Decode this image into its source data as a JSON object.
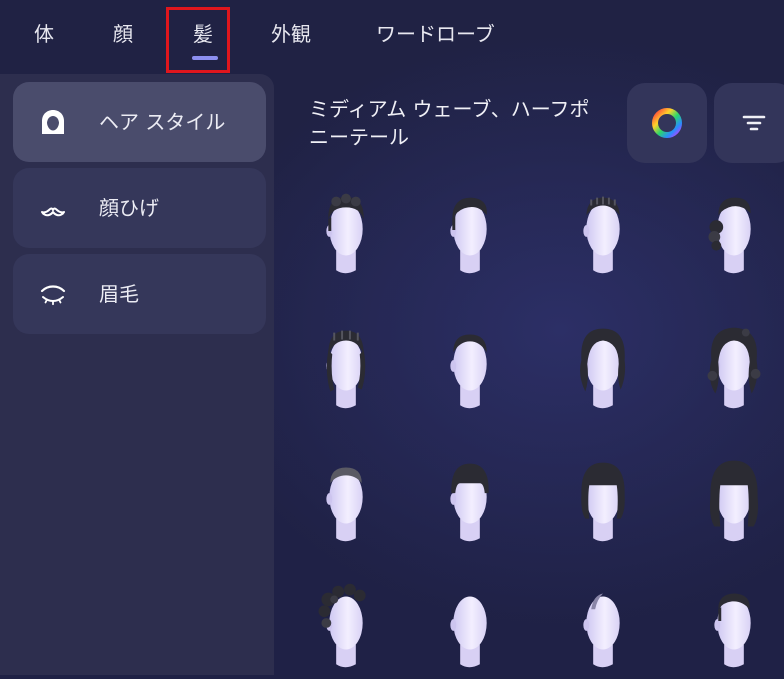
{
  "tabs": [
    {
      "label": "体"
    },
    {
      "label": "顔"
    },
    {
      "label": "髪"
    },
    {
      "label": "外観"
    },
    {
      "label": "ワードローブ"
    }
  ],
  "active_tab": "髪",
  "sidebar": {
    "items": [
      {
        "label": "ヘア スタイル",
        "icon": "hair-style-icon",
        "active": true
      },
      {
        "label": "顔ひげ",
        "icon": "mustache-icon",
        "active": false
      },
      {
        "label": "眉毛",
        "icon": "eyebrow-icon",
        "active": false
      }
    ]
  },
  "main": {
    "title": "ミディアム ウェーブ、ハーフポニーテール",
    "color_button_icon": "color-wheel-icon",
    "filter_button_icon": "filter-icon",
    "hairstyles": [
      "short-curly-top",
      "short-side-part",
      "short-braid-top",
      "braided-side-bun",
      "braided-medium",
      "short-cropped",
      "medium-wavy",
      "medium-curly",
      "buzz-cut-fade",
      "bowl-cut",
      "bob-with-bangs",
      "long-bob-with-bangs",
      "afro-puffs",
      "bald",
      "shaved-side",
      "short-slick"
    ]
  },
  "colors": {
    "accent": "#8c8ff0",
    "highlight_box": "#e0161d"
  }
}
